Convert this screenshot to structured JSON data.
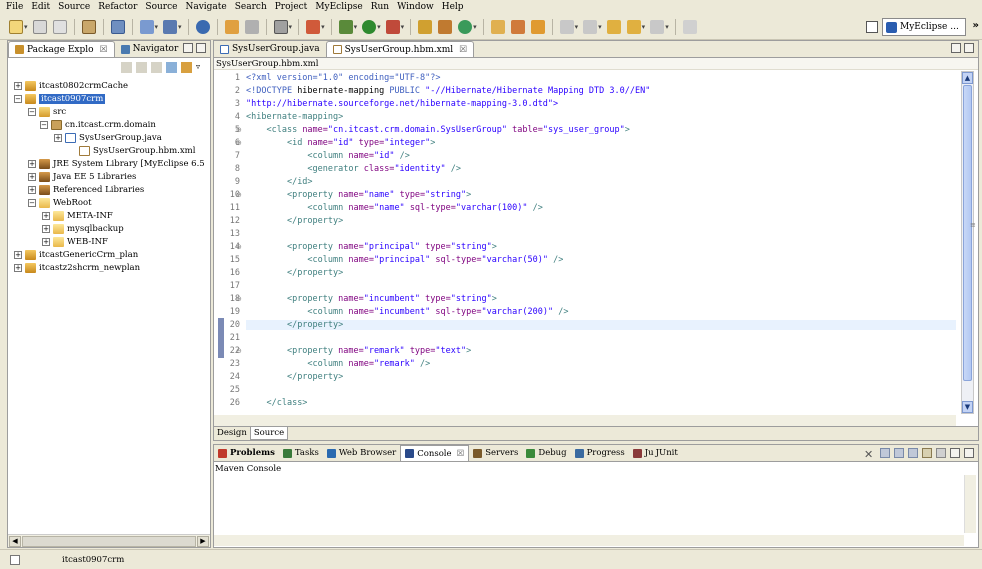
{
  "menubar": {
    "items": [
      "File",
      "Edit",
      "Source",
      "Refactor",
      "Source",
      "Navigate",
      "Search",
      "Project",
      "MyEclipse",
      "Run",
      "Window",
      "Help"
    ]
  },
  "perspective": {
    "label": "MyEclipse ...",
    "overflow": "»"
  },
  "left_view": {
    "tabs": [
      {
        "label": "Package Explo",
        "close": "☒",
        "active": true
      },
      {
        "label": "Navigator",
        "active": false
      }
    ],
    "tree": [
      {
        "label": "itcast0802crmCache",
        "expander": "+",
        "icon": "project"
      },
      {
        "label": "itcast0907crm",
        "expander": "−",
        "icon": "project",
        "selected": true
      },
      {
        "label": "src",
        "expander": "−",
        "icon": "source-folder"
      },
      {
        "label": "cn.itcast.crm.domain",
        "expander": "−",
        "icon": "package"
      },
      {
        "label": "SysUserGroup.java",
        "expander": "+",
        "icon": "java-file"
      },
      {
        "label": "SysUserGroup.hbm.xml",
        "expander": "",
        "icon": "xml-file"
      },
      {
        "label": "JRE System Library [MyEclipse 6.5",
        "expander": "+",
        "icon": "library"
      },
      {
        "label": "Java EE 5 Libraries",
        "expander": "+",
        "icon": "library"
      },
      {
        "label": "Referenced Libraries",
        "expander": "+",
        "icon": "library"
      },
      {
        "label": "WebRoot",
        "expander": "−",
        "icon": "folder"
      },
      {
        "label": "META-INF",
        "expander": "+",
        "icon": "folder"
      },
      {
        "label": "mysqlbackup",
        "expander": "+",
        "icon": "folder"
      },
      {
        "label": "WEB-INF",
        "expander": "+",
        "icon": "folder"
      },
      {
        "label": "itcastGenericCrm_plan",
        "expander": "+",
        "icon": "project"
      },
      {
        "label": "itcastz2shcrm_newplan",
        "expander": "+",
        "icon": "project"
      }
    ],
    "scroll_thumb": "⁞⁞"
  },
  "editor": {
    "tabs": [
      {
        "label": "SysUserGroup.java",
        "active": false
      },
      {
        "label": "SysUserGroup.hbm.xml",
        "close": "☒",
        "active": true
      }
    ],
    "breadcrumb": "SysUserGroup.hbm.xml",
    "lines": [
      {
        "n": "1",
        "fold": "",
        "parts": [
          [
            "pi",
            "<?xml version=\"1.0\" encoding=\"UTF-8\"?>"
          ]
        ]
      },
      {
        "n": "2",
        "fold": "",
        "parts": [
          [
            "pi",
            "<!DOCTYPE "
          ],
          [
            "dt",
            "hibernate-mapping "
          ],
          [
            "pi",
            "PUBLIC "
          ],
          [
            "val",
            "\"-//Hibernate/Hibernate Mapping DTD 3.0//EN\""
          ]
        ]
      },
      {
        "n": "3",
        "fold": "",
        "parts": [
          [
            "val",
            "\"http://hibernate.sourceforge.net/hibernate-mapping-3.0.dtd\">"
          ]
        ]
      },
      {
        "n": "4",
        "fold": "",
        "parts": [
          [
            "tag",
            "<hibernate-mapping>"
          ]
        ]
      },
      {
        "n": "5",
        "fold": "⊖",
        "parts": [
          [
            "sp",
            "    "
          ],
          [
            "tag",
            "<class "
          ],
          [
            "attr",
            "name="
          ],
          [
            "val",
            "\"cn.itcast.crm.domain.SysUserGroup\""
          ],
          [
            "sp",
            " "
          ],
          [
            "attr",
            "table="
          ],
          [
            "val",
            "\"sys_user_group\""
          ],
          [
            "tag",
            ">"
          ]
        ]
      },
      {
        "n": "6",
        "fold": "⊖",
        "parts": [
          [
            "sp",
            "        "
          ],
          [
            "tag",
            "<id "
          ],
          [
            "attr",
            "name="
          ],
          [
            "val",
            "\"id\""
          ],
          [
            "sp",
            " "
          ],
          [
            "attr",
            "type="
          ],
          [
            "val",
            "\"integer\""
          ],
          [
            "tag",
            ">"
          ]
        ]
      },
      {
        "n": "7",
        "fold": "",
        "parts": [
          [
            "sp",
            "            "
          ],
          [
            "tag",
            "<column "
          ],
          [
            "attr",
            "name="
          ],
          [
            "val",
            "\"id\""
          ],
          [
            "tag",
            " />"
          ]
        ]
      },
      {
        "n": "8",
        "fold": "",
        "parts": [
          [
            "sp",
            "            "
          ],
          [
            "tag",
            "<generator "
          ],
          [
            "attr",
            "class="
          ],
          [
            "val",
            "\"identity\""
          ],
          [
            "tag",
            " />"
          ]
        ]
      },
      {
        "n": "9",
        "fold": "",
        "parts": [
          [
            "sp",
            "        "
          ],
          [
            "tag",
            "</id>"
          ]
        ]
      },
      {
        "n": "10",
        "fold": "⊖",
        "parts": [
          [
            "sp",
            "        "
          ],
          [
            "tag",
            "<property "
          ],
          [
            "attr",
            "name="
          ],
          [
            "val",
            "\"name\""
          ],
          [
            "sp",
            " "
          ],
          [
            "attr",
            "type="
          ],
          [
            "val",
            "\"string\""
          ],
          [
            "tag",
            ">"
          ]
        ]
      },
      {
        "n": "11",
        "fold": "",
        "parts": [
          [
            "sp",
            "            "
          ],
          [
            "tag",
            "<column "
          ],
          [
            "attr",
            "name="
          ],
          [
            "val",
            "\"name\""
          ],
          [
            "sp",
            " "
          ],
          [
            "attr",
            "sql-type="
          ],
          [
            "val",
            "\"varchar(100)\""
          ],
          [
            "tag",
            " />"
          ]
        ]
      },
      {
        "n": "12",
        "fold": "",
        "parts": [
          [
            "sp",
            "        "
          ],
          [
            "tag",
            "</property>"
          ]
        ]
      },
      {
        "n": "13",
        "fold": "",
        "parts": []
      },
      {
        "n": "14",
        "fold": "⊖",
        "parts": [
          [
            "sp",
            "        "
          ],
          [
            "tag",
            "<property "
          ],
          [
            "attr",
            "name="
          ],
          [
            "val",
            "\"principal\""
          ],
          [
            "sp",
            " "
          ],
          [
            "attr",
            "type="
          ],
          [
            "val",
            "\"string\""
          ],
          [
            "tag",
            ">"
          ]
        ]
      },
      {
        "n": "15",
        "fold": "",
        "parts": [
          [
            "sp",
            "            "
          ],
          [
            "tag",
            "<column "
          ],
          [
            "attr",
            "name="
          ],
          [
            "val",
            "\"principal\""
          ],
          [
            "sp",
            " "
          ],
          [
            "attr",
            "sql-type="
          ],
          [
            "val",
            "\"varchar(50)\""
          ],
          [
            "tag",
            " />"
          ]
        ]
      },
      {
        "n": "16",
        "fold": "",
        "parts": [
          [
            "sp",
            "        "
          ],
          [
            "tag",
            "</property>"
          ]
        ]
      },
      {
        "n": "17",
        "fold": "",
        "parts": []
      },
      {
        "n": "18",
        "fold": "⊖",
        "parts": [
          [
            "sp",
            "        "
          ],
          [
            "tag",
            "<property "
          ],
          [
            "attr",
            "name="
          ],
          [
            "val",
            "\"incumbent\""
          ],
          [
            "sp",
            " "
          ],
          [
            "attr",
            "type="
          ],
          [
            "val",
            "\"string\""
          ],
          [
            "tag",
            ">"
          ]
        ]
      },
      {
        "n": "19",
        "fold": "",
        "parts": [
          [
            "sp",
            "            "
          ],
          [
            "tag",
            "<column "
          ],
          [
            "attr",
            "name="
          ],
          [
            "val",
            "\"incumbent\""
          ],
          [
            "sp",
            " "
          ],
          [
            "attr",
            "sql-type="
          ],
          [
            "val",
            "\"varchar(200)\""
          ],
          [
            "tag",
            " />"
          ]
        ]
      },
      {
        "n": "20",
        "fold": "",
        "current": true,
        "parts": [
          [
            "sp",
            "        "
          ],
          [
            "tag",
            "</property>"
          ]
        ]
      },
      {
        "n": "21",
        "fold": "",
        "parts": []
      },
      {
        "n": "22",
        "fold": "⊖",
        "parts": [
          [
            "sp",
            "        "
          ],
          [
            "tag",
            "<property "
          ],
          [
            "attr",
            "name="
          ],
          [
            "val",
            "\"remark\""
          ],
          [
            "sp",
            " "
          ],
          [
            "attr",
            "type="
          ],
          [
            "val",
            "\"text\""
          ],
          [
            "tag",
            ">"
          ]
        ]
      },
      {
        "n": "23",
        "fold": "",
        "parts": [
          [
            "sp",
            "            "
          ],
          [
            "tag",
            "<column "
          ],
          [
            "attr",
            "name="
          ],
          [
            "val",
            "\"remark\""
          ],
          [
            "tag",
            " />"
          ]
        ]
      },
      {
        "n": "24",
        "fold": "",
        "parts": [
          [
            "sp",
            "        "
          ],
          [
            "tag",
            "</property>"
          ]
        ]
      },
      {
        "n": "25",
        "fold": "",
        "parts": []
      },
      {
        "n": "26",
        "fold": "",
        "parts": [
          [
            "sp",
            "    "
          ],
          [
            "tag",
            "</class>"
          ]
        ]
      }
    ],
    "bottom_tabs": [
      {
        "label": "Design",
        "active": false
      },
      {
        "label": "Source",
        "active": true
      }
    ],
    "scroll_mid": "≡"
  },
  "bottom_view": {
    "tabs": [
      {
        "label": "Problems",
        "bold": true,
        "icon_color": "#c0392b"
      },
      {
        "label": "Tasks",
        "icon_color": "#3a7a3a"
      },
      {
        "label": "Web Browser",
        "icon_color": "#2a6ab0"
      },
      {
        "label": "Console",
        "close": "☒",
        "active": true,
        "icon_color": "#2a4a8a"
      },
      {
        "label": "Servers",
        "icon_color": "#7a5a2a"
      },
      {
        "label": "Debug",
        "icon_color": "#3a8a3a"
      },
      {
        "label": "Progress",
        "icon_color": "#3a6aa0"
      },
      {
        "label": "JUnit",
        "prefix": "Ju",
        "icon_color": "#8a3a3a"
      }
    ],
    "console_title": "Maven Console"
  },
  "status_bar": {
    "text": "itcast0907crm"
  },
  "colors": {
    "chrome": "#ece9d8",
    "selection": "#316ac5",
    "xml_tag": "#3f7f7f",
    "xml_attr": "#7f007f",
    "xml_value": "#2a00ff",
    "xml_pi": "#3f5fbf",
    "current_line": "#e8f2fe"
  }
}
